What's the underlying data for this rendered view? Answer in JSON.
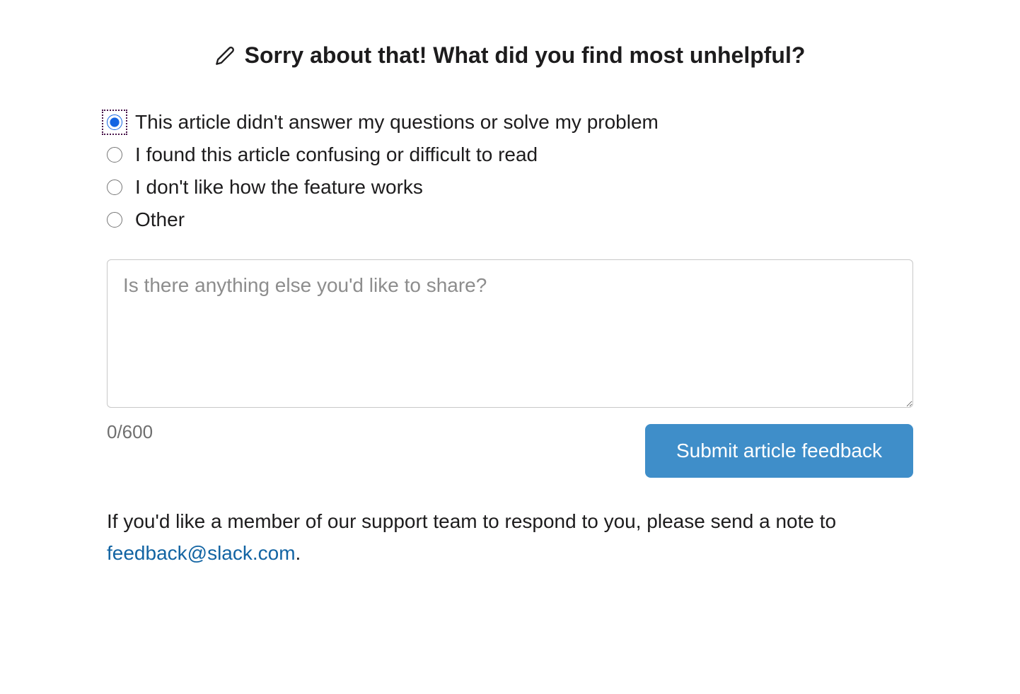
{
  "heading": "Sorry about that! What did you find most unhelpful?",
  "options": [
    {
      "label": "This article didn't answer my questions or solve my problem",
      "selected": true
    },
    {
      "label": "I found this article confusing or difficult to read",
      "selected": false
    },
    {
      "label": "I don't like how the feature works",
      "selected": false
    },
    {
      "label": "Other",
      "selected": false
    }
  ],
  "textarea": {
    "placeholder": "Is there anything else you'd like to share?",
    "value": ""
  },
  "char_counter": "0/600",
  "submit_label": "Submit article feedback",
  "footer": {
    "prefix": "If you'd like a member of our support team to respond to you, please send a note to ",
    "link_text": "feedback@slack.com",
    "suffix": "."
  }
}
